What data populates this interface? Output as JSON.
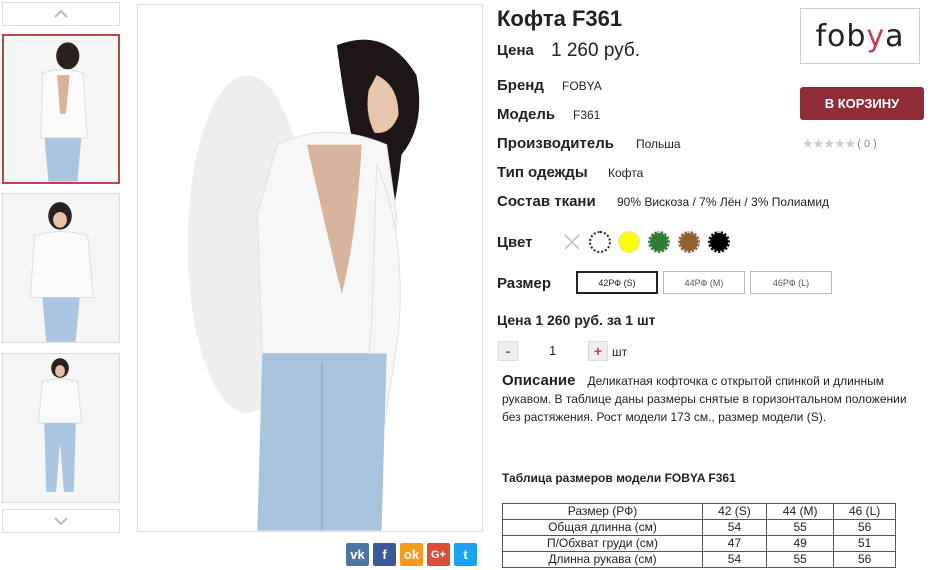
{
  "product": {
    "title": "Кофта F361",
    "price_label": "Цена",
    "price_value": "1 260 руб.",
    "brand_label": "Бренд",
    "brand_value": "FOBYA",
    "model_label": "Модель",
    "model_value": "F361",
    "maker_label": "Производитель",
    "maker_value": "Польша",
    "type_label": "Тип одежды",
    "type_value": "Кофта",
    "fabric_label": "Состав ткани",
    "fabric_value": "90% Вискоза / 7% Лён / 3% Полиамид",
    "color_label": "Цвет",
    "size_label": "Размер"
  },
  "logo": {
    "text_a": "fob",
    "text_y": "y",
    "text_b": "a"
  },
  "cart": {
    "button_label": "В КОРЗИНУ"
  },
  "rating": {
    "stars": "★★★★★",
    "count": "( 0 )",
    "value": 0
  },
  "colors": [
    "none",
    "#ffffff",
    "#ffff00",
    "#2e7d32",
    "#8d6230",
    "#000000"
  ],
  "sizes": [
    {
      "label": "42РФ (S)",
      "selected": true
    },
    {
      "label": "44РФ (M)",
      "selected": false
    },
    {
      "label": "46РФ (L)",
      "selected": false
    }
  ],
  "order": {
    "total_text": "Цена 1 260 руб. за 1 шт",
    "minus": "-",
    "plus": "+",
    "quantity": "1",
    "unit": "шт"
  },
  "description": {
    "title": "Описание",
    "text": "Деликатная кофточка с открытой спинкой и длинным рукавом. В таблице даны размеры снятые в горизонтальном положении без растяжения. Рост модели 173 см., размер модели (S)."
  },
  "size_table": {
    "title": "Таблица размеров модели FOBYA F361",
    "header": [
      "Размер (РФ)",
      "42 (S)",
      "44 (M)",
      "46 (L)"
    ],
    "rows": [
      [
        "Общая длинна (см)",
        "54",
        "55",
        "56"
      ],
      [
        "П/Обхват груди (см)",
        "47",
        "49",
        "51"
      ],
      [
        "Длинна рукава (см)",
        "54",
        "55",
        "56"
      ]
    ]
  },
  "share": [
    {
      "name": "vk",
      "glyph": "vk",
      "color": "#4c75a3"
    },
    {
      "name": "facebook",
      "glyph": "f",
      "color": "#3b5998"
    },
    {
      "name": "odnoklassniki",
      "glyph": "ok",
      "color": "#f59a1b"
    },
    {
      "name": "google-plus",
      "glyph": "G+",
      "color": "#dd4b39"
    },
    {
      "name": "twitter",
      "glyph": "t",
      "color": "#1da1f2"
    }
  ]
}
